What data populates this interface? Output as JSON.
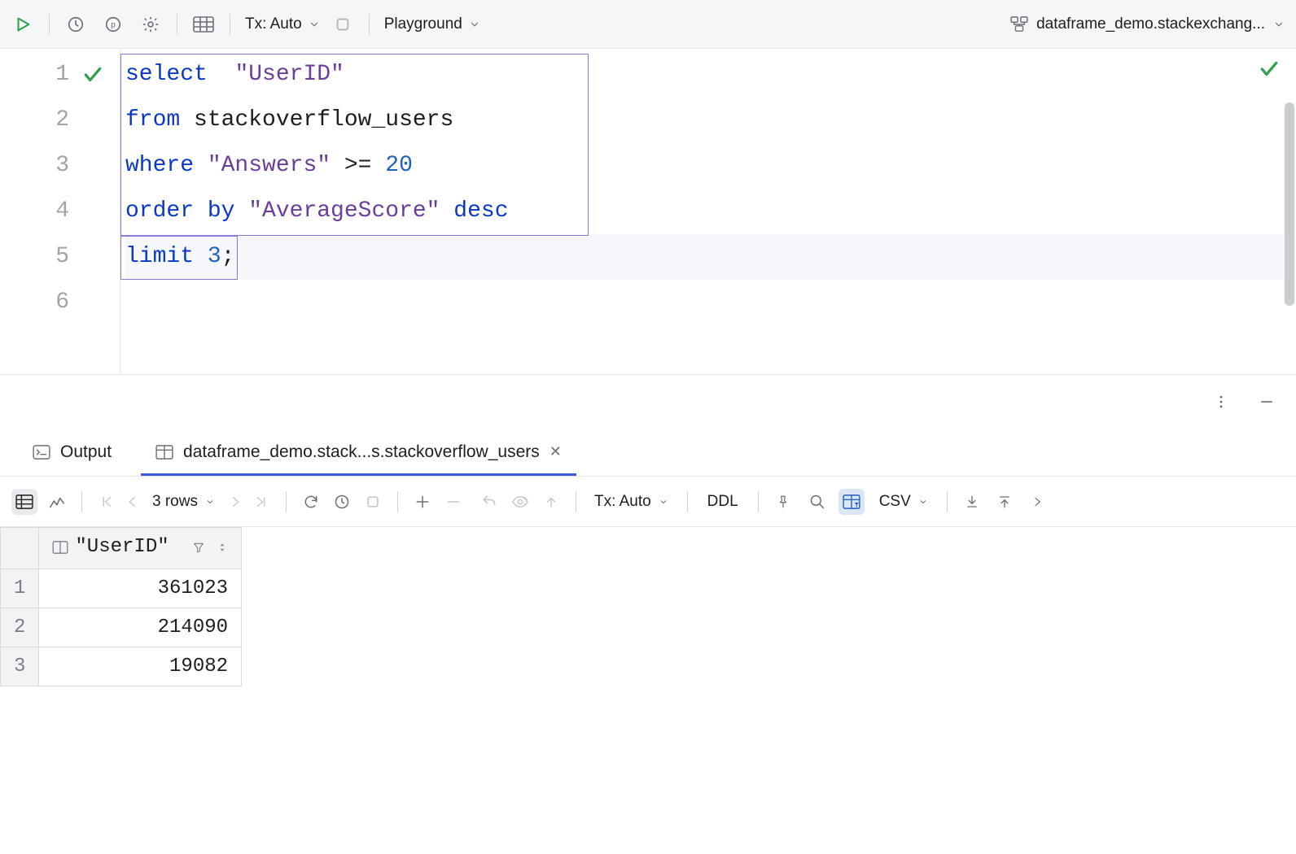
{
  "toolbar": {
    "tx_label": "Tx: Auto",
    "playground_label": "Playground",
    "session_label": "dataframe_demo.stackexchang..."
  },
  "editor": {
    "lines": [
      {
        "n": 1,
        "marker": "check"
      },
      {
        "n": 2,
        "marker": ""
      },
      {
        "n": 3,
        "marker": ""
      },
      {
        "n": 4,
        "marker": ""
      },
      {
        "n": 5,
        "marker": ""
      },
      {
        "n": 6,
        "marker": ""
      }
    ],
    "code": {
      "l1": {
        "kw": "select",
        "str": "\"UserID\""
      },
      "l2": {
        "kw": "from",
        "ident": "stackoverflow_users"
      },
      "l3": {
        "kw": "where",
        "str": "\"Answers\"",
        "op": " >= ",
        "num": "20"
      },
      "l4": {
        "kw": "order by",
        "str": "\"AverageScore\"",
        "kw2": "desc"
      },
      "l5": {
        "kw": "limit",
        "num": "3",
        "semi": ";"
      }
    }
  },
  "tabs": {
    "output_label": "Output",
    "data_label": "dataframe_demo.stack...s.stackoverflow_users"
  },
  "result_toolbar": {
    "rows_label": "3 rows",
    "tx_label": "Tx: Auto",
    "ddl_label": "DDL",
    "format_label": "CSV"
  },
  "grid": {
    "column": "\"UserID\"",
    "rows": [
      {
        "n": 1,
        "v": "361023"
      },
      {
        "n": 2,
        "v": "214090"
      },
      {
        "n": 3,
        "v": "19082"
      }
    ]
  }
}
